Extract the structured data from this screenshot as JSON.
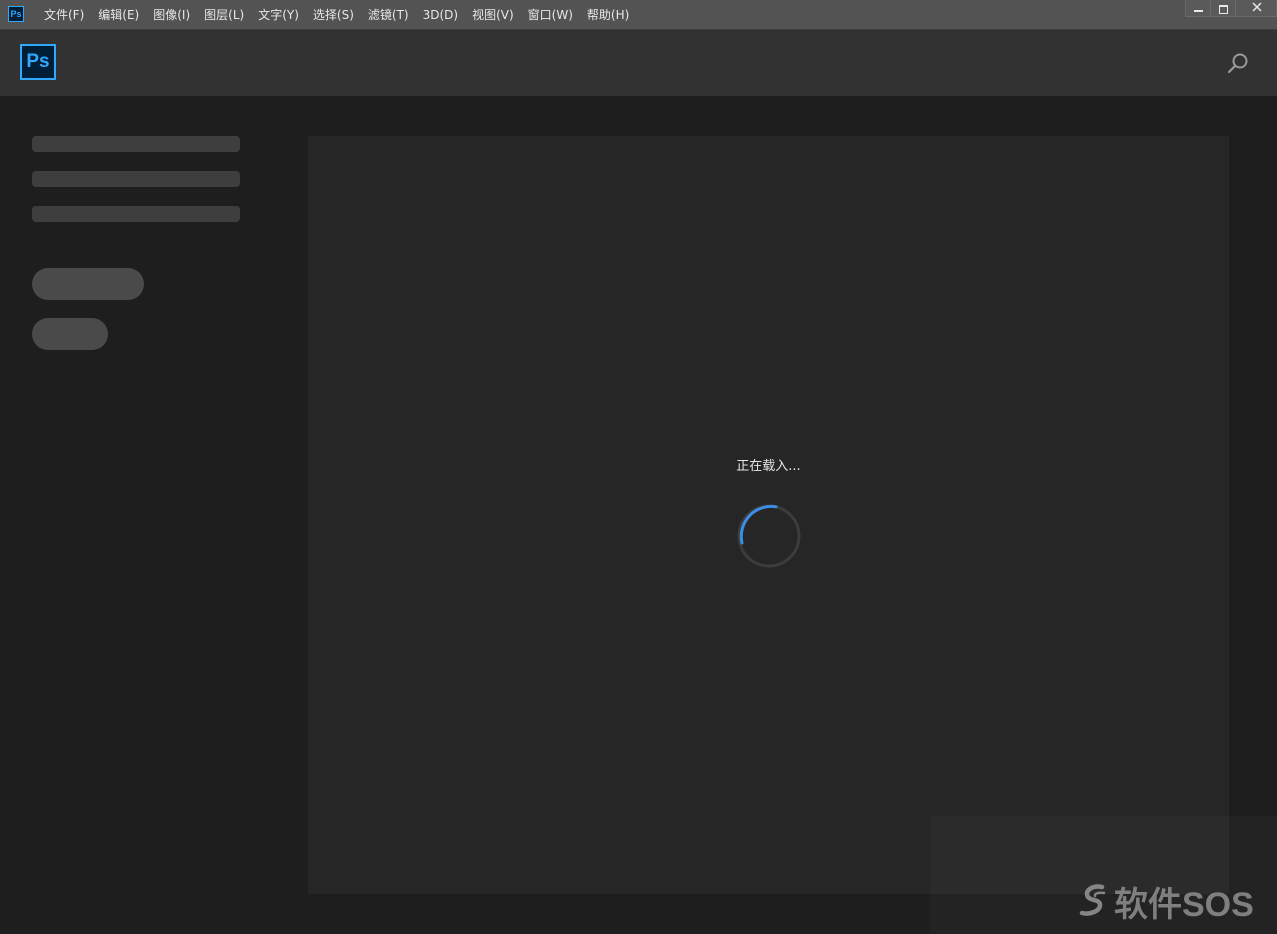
{
  "app": {
    "icon_text": "Ps",
    "logo_text": "Ps"
  },
  "menu": {
    "items": [
      {
        "label": "文件(F)"
      },
      {
        "label": "编辑(E)"
      },
      {
        "label": "图像(I)"
      },
      {
        "label": "图层(L)"
      },
      {
        "label": "文字(Y)"
      },
      {
        "label": "选择(S)"
      },
      {
        "label": "滤镜(T)"
      },
      {
        "label": "3D(D)"
      },
      {
        "label": "视图(V)"
      },
      {
        "label": "窗口(W)"
      },
      {
        "label": "帮助(H)"
      }
    ]
  },
  "window_controls": {
    "icons": [
      "minimize-icon",
      "maximize-icon",
      "close-icon"
    ]
  },
  "header": {
    "search_icon": "search-icon"
  },
  "main": {
    "loading_text": "正在载入..."
  },
  "watermark": {
    "text": "软件SOS"
  },
  "colors": {
    "menubar": "#535353",
    "header": "#323232",
    "background": "#1e1e1e",
    "panel": "#262626",
    "accent": "#31a8ff",
    "spinner_accent": "#3a8ee6"
  }
}
